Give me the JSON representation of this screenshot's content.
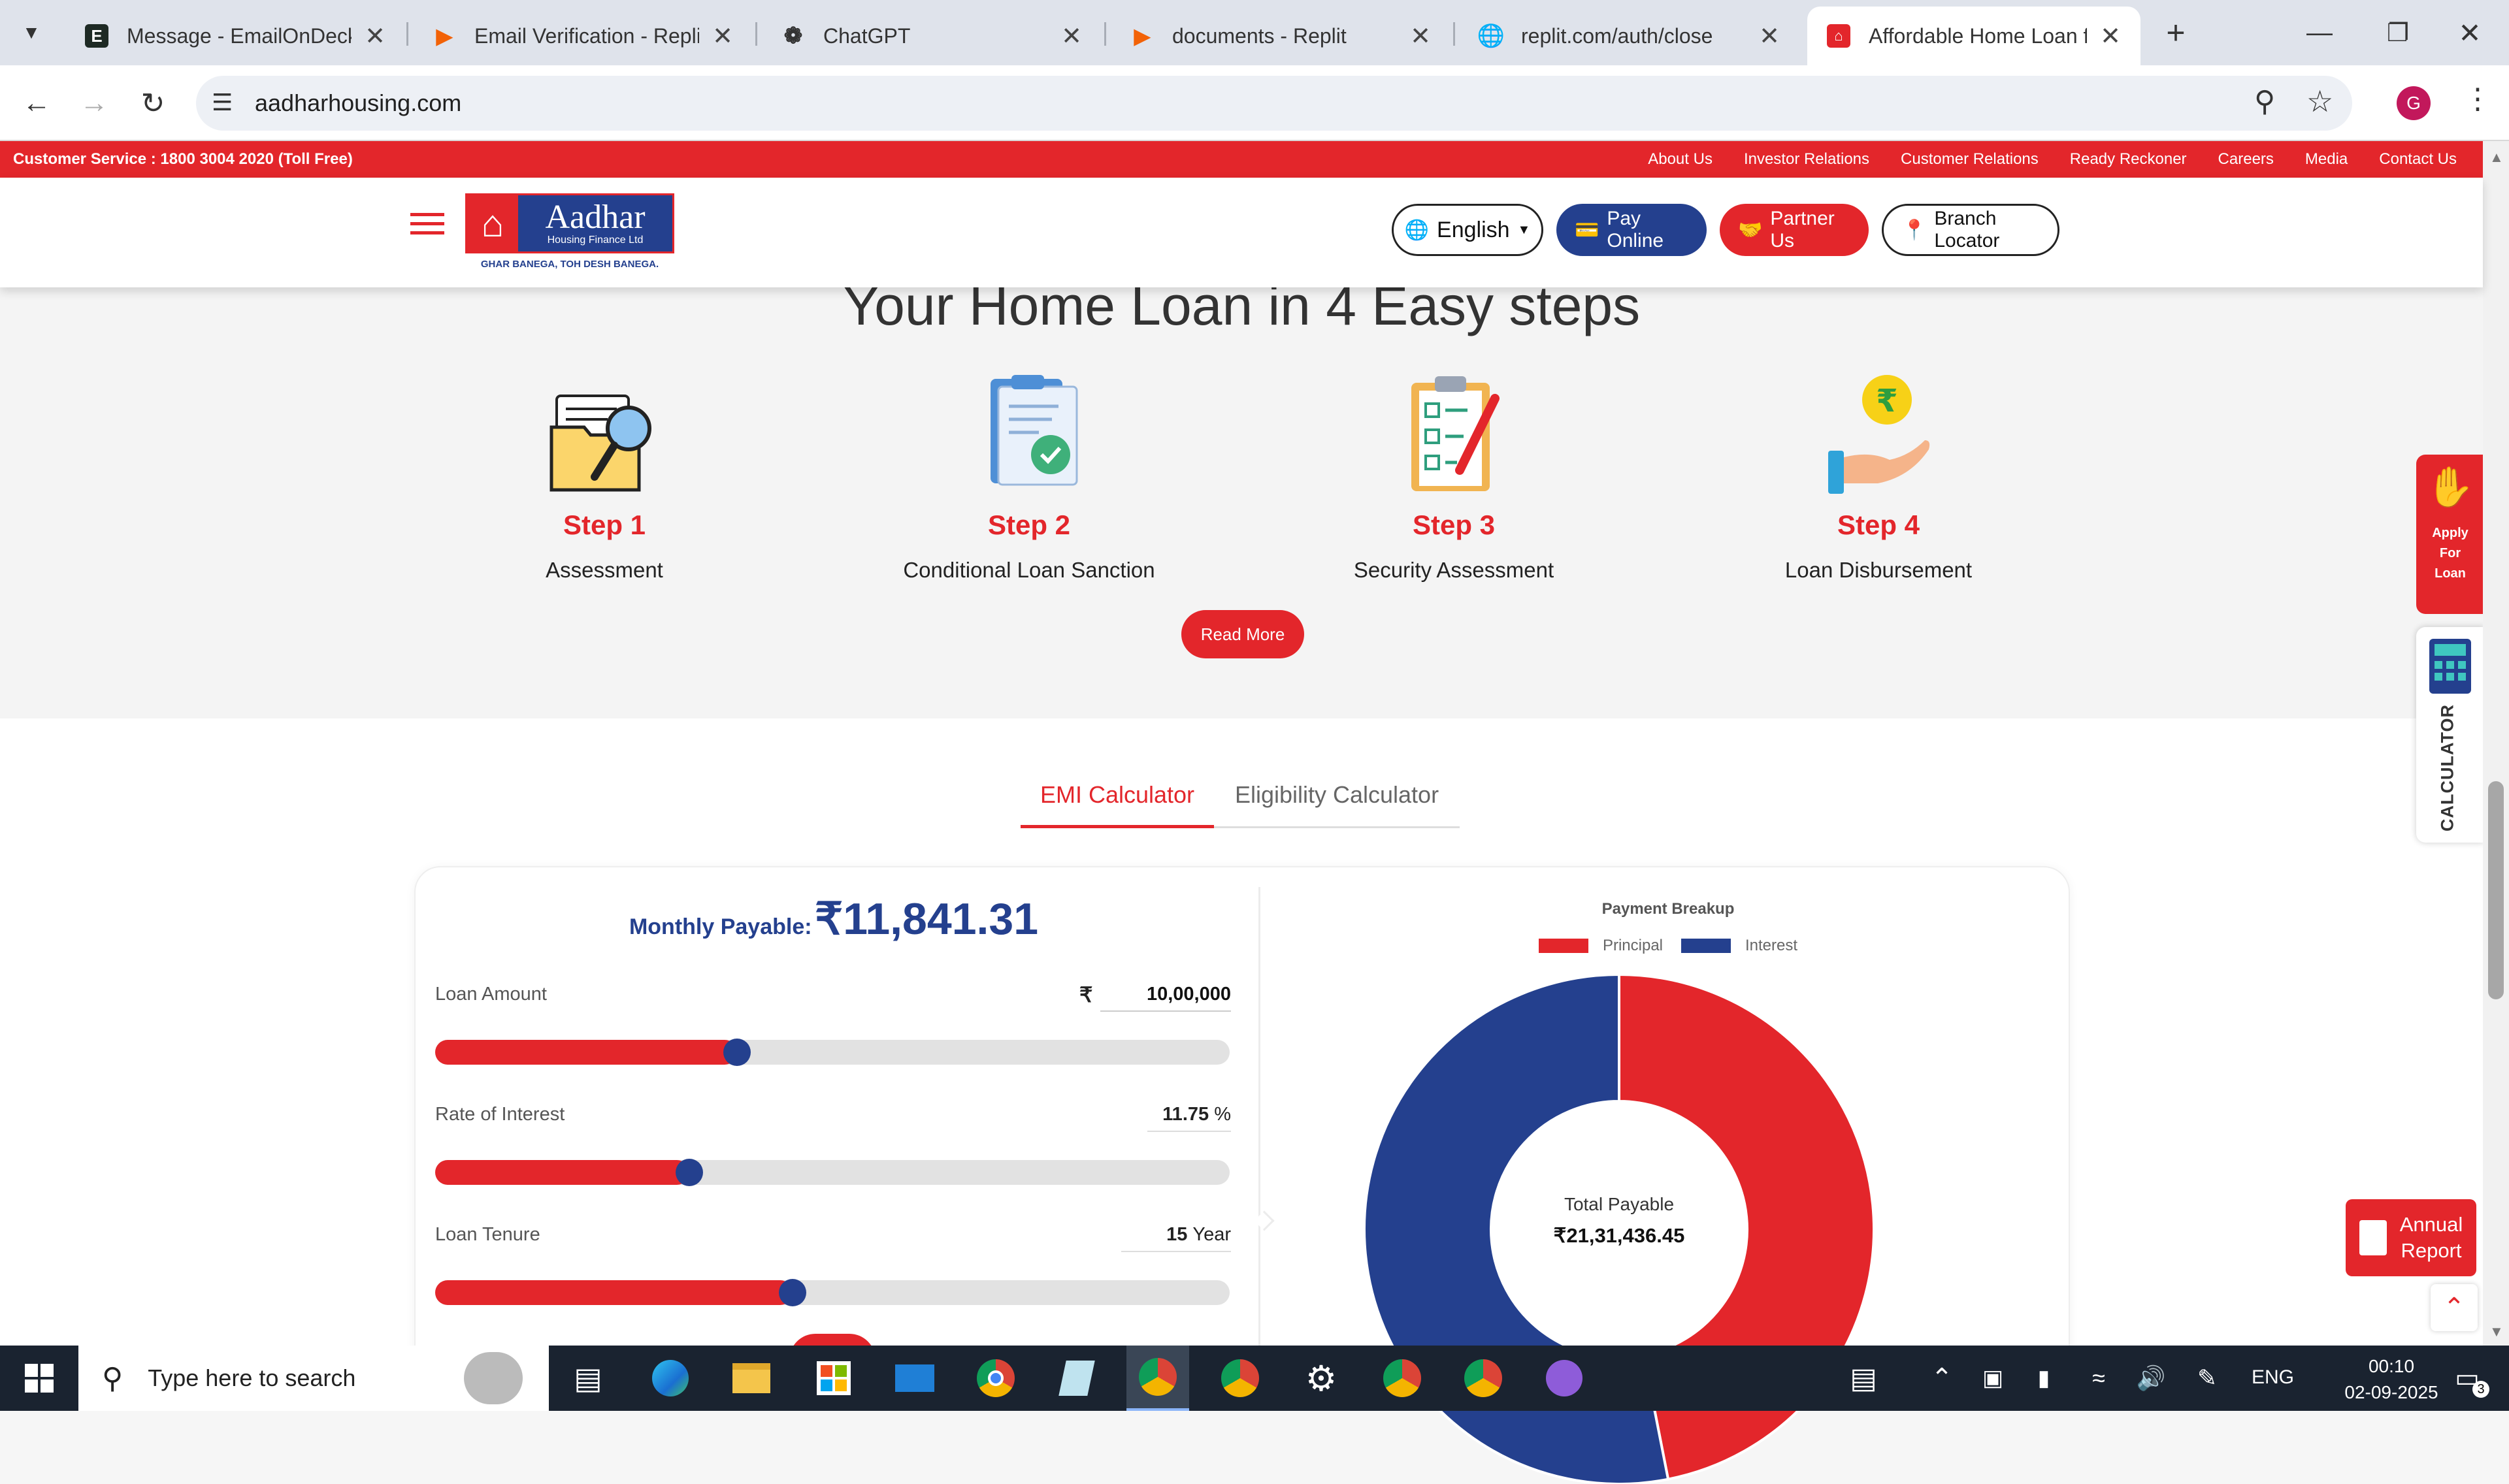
{
  "browser": {
    "tabs": [
      {
        "title": "Message - EmailOnDeck",
        "favicon": "emailondeck-icon"
      },
      {
        "title": "Email Verification - Replit",
        "favicon": "replit-icon"
      },
      {
        "title": "ChatGPT",
        "favicon": "chatgpt-icon"
      },
      {
        "title": "documents - Replit",
        "favicon": "replit-icon"
      },
      {
        "title": "replit.com/auth/close",
        "favicon": "globe-icon"
      },
      {
        "title": "Affordable Home Loan for",
        "favicon": "aadhar-icon",
        "active": true
      }
    ],
    "url": "aadharhousing.com",
    "profile_initial": "G"
  },
  "topbar": {
    "customer_service": "Customer Service : 1800 3004 2020 (Toll Free)",
    "links": [
      "About Us",
      "Investor Relations",
      "Customer Relations",
      "Ready Reckoner",
      "Careers",
      "Media",
      "Contact Us"
    ]
  },
  "header": {
    "logo_name": "Aadhar",
    "logo_sub": "Housing Finance Ltd",
    "tagline": "GHAR BANEGA, TOH DESH BANEGA.",
    "language": "English",
    "pay_online": "Pay Online",
    "partner_us": "Partner Us",
    "branch_locator": "Branch Locator"
  },
  "steps": {
    "title": "Your Home Loan in 4 Easy steps",
    "items": [
      {
        "step": "Step 1",
        "label": "Assessment",
        "icon": "folder-search-icon"
      },
      {
        "step": "Step 2",
        "label": "Conditional Loan Sanction",
        "icon": "clipboard-check-icon"
      },
      {
        "step": "Step 3",
        "label": "Security Assessment",
        "icon": "checklist-pen-icon"
      },
      {
        "step": "Step 4",
        "label": "Loan Disbursement",
        "icon": "hand-rupee-coin-icon"
      }
    ],
    "read_more": "Read More"
  },
  "calculator": {
    "tabs": [
      "EMI Calculator",
      "Eligibility Calculator"
    ],
    "active_tab": "EMI Calculator",
    "monthly_label": "Monthly Payable:",
    "monthly_value": "₹11,841.31",
    "loan_amount": {
      "label": "Loan Amount",
      "currency": "₹",
      "value": "10,00,000",
      "fraction": 0.38
    },
    "interest": {
      "label": "Rate of Interest",
      "value": "11.75",
      "unit": "%",
      "fraction": 0.32
    },
    "tenure": {
      "label": "Loan Tenure",
      "value": "15",
      "unit": "Year",
      "fraction": 0.45
    },
    "breakup": {
      "title": "Payment Breakup",
      "legend": [
        {
          "name": "Principal",
          "color": "#e3262b"
        },
        {
          "name": "Interest",
          "color": "#24408e"
        }
      ],
      "total_label": "Total Payable",
      "total_value": "₹21,31,436.45"
    }
  },
  "chart_data": {
    "type": "pie",
    "title": "Payment Breakup",
    "categories": [
      "Principal",
      "Interest"
    ],
    "values": [
      1000000,
      1131436.45
    ],
    "colors": [
      "#e3262b",
      "#24408e"
    ],
    "legend": "top"
  },
  "side": {
    "apply": [
      "Apply",
      "For",
      "Loan"
    ],
    "calculator": "CALCULATOR",
    "annual_report": [
      "Annual",
      "Report"
    ]
  },
  "taskbar": {
    "search_placeholder": "Type here to search",
    "language": "ENG",
    "time": "00:10",
    "date": "02-09-2025",
    "notifications": "3"
  },
  "colors": {
    "brand_red": "#e3262b",
    "brand_blue": "#24408e"
  }
}
